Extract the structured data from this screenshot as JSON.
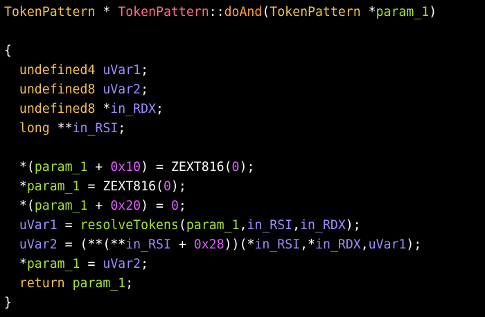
{
  "palette": {
    "default": "#ffffff",
    "type": "#f2c14e",
    "class_name": "#ff6b8b",
    "function": "#ff9d3f",
    "call": "#a6e22e",
    "param": "#a6e22e",
    "variable": "#9d8cff",
    "number": "#e05cff",
    "keyword": "#f2c14e"
  },
  "editor": {
    "lines": [
      {
        "tokens": [
          {
            "t": "TokenPattern",
            "c": "type"
          },
          {
            "t": " * ",
            "c": "default"
          },
          {
            "t": "TokenPattern",
            "c": "class_name"
          },
          {
            "t": "::",
            "c": "default"
          },
          {
            "t": "doAnd",
            "c": "function"
          },
          {
            "t": "(",
            "c": "default"
          },
          {
            "t": "TokenPattern",
            "c": "type"
          },
          {
            "t": " *",
            "c": "default"
          },
          {
            "t": "param_1",
            "c": "param"
          },
          {
            "t": ")",
            "c": "default"
          }
        ]
      },
      {
        "tokens": []
      },
      {
        "tokens": [
          {
            "t": "{",
            "c": "default"
          }
        ]
      },
      {
        "tokens": [
          {
            "t": "  ",
            "c": "default"
          },
          {
            "t": "undefined4",
            "c": "type"
          },
          {
            "t": " ",
            "c": "default"
          },
          {
            "t": "uVar1",
            "c": "variable"
          },
          {
            "t": ";",
            "c": "default"
          }
        ]
      },
      {
        "tokens": [
          {
            "t": "  ",
            "c": "default"
          },
          {
            "t": "undefined8",
            "c": "type"
          },
          {
            "t": " ",
            "c": "default"
          },
          {
            "t": "uVar2",
            "c": "variable"
          },
          {
            "t": ";",
            "c": "default"
          }
        ]
      },
      {
        "tokens": [
          {
            "t": "  ",
            "c": "default"
          },
          {
            "t": "undefined8",
            "c": "type"
          },
          {
            "t": " *",
            "c": "default"
          },
          {
            "t": "in_RDX",
            "c": "variable"
          },
          {
            "t": ";",
            "c": "default"
          }
        ]
      },
      {
        "tokens": [
          {
            "t": "  ",
            "c": "default"
          },
          {
            "t": "long",
            "c": "type"
          },
          {
            "t": " **",
            "c": "default"
          },
          {
            "t": "in_RSI",
            "c": "variable"
          },
          {
            "t": ";",
            "c": "default"
          }
        ]
      },
      {
        "tokens": []
      },
      {
        "tokens": [
          {
            "t": "  *(",
            "c": "default"
          },
          {
            "t": "param_1",
            "c": "param"
          },
          {
            "t": " + ",
            "c": "default"
          },
          {
            "t": "0x10",
            "c": "number"
          },
          {
            "t": ") = ZEXT816(",
            "c": "default"
          },
          {
            "t": "0",
            "c": "number"
          },
          {
            "t": ");",
            "c": "default"
          }
        ]
      },
      {
        "tokens": [
          {
            "t": "  *",
            "c": "default"
          },
          {
            "t": "param_1",
            "c": "param"
          },
          {
            "t": " = ZEXT816(",
            "c": "default"
          },
          {
            "t": "0",
            "c": "number"
          },
          {
            "t": ");",
            "c": "default"
          }
        ]
      },
      {
        "tokens": [
          {
            "t": "  *(",
            "c": "default"
          },
          {
            "t": "param_1",
            "c": "param"
          },
          {
            "t": " + ",
            "c": "default"
          },
          {
            "t": "0x20",
            "c": "number"
          },
          {
            "t": ") = ",
            "c": "default"
          },
          {
            "t": "0",
            "c": "number"
          },
          {
            "t": ";",
            "c": "default"
          }
        ]
      },
      {
        "tokens": [
          {
            "t": "  ",
            "c": "default"
          },
          {
            "t": "uVar1",
            "c": "variable"
          },
          {
            "t": " = ",
            "c": "default"
          },
          {
            "t": "resolveTokens",
            "c": "call"
          },
          {
            "t": "(",
            "c": "default"
          },
          {
            "t": "param_1",
            "c": "param"
          },
          {
            "t": ",",
            "c": "default"
          },
          {
            "t": "in_RSI",
            "c": "variable"
          },
          {
            "t": ",",
            "c": "default"
          },
          {
            "t": "in_RDX",
            "c": "variable"
          },
          {
            "t": ");",
            "c": "default"
          }
        ]
      },
      {
        "tokens": [
          {
            "t": "  ",
            "c": "default"
          },
          {
            "t": "uVar2",
            "c": "variable"
          },
          {
            "t": " = (**(**",
            "c": "default"
          },
          {
            "t": "in_RSI",
            "c": "variable"
          },
          {
            "t": " + ",
            "c": "default"
          },
          {
            "t": "0x28",
            "c": "number"
          },
          {
            "t": "))(*",
            "c": "default"
          },
          {
            "t": "in_RSI",
            "c": "variable"
          },
          {
            "t": ",*",
            "c": "default"
          },
          {
            "t": "in_RDX",
            "c": "variable"
          },
          {
            "t": ",",
            "c": "default"
          },
          {
            "t": "uVar1",
            "c": "variable"
          },
          {
            "t": ");",
            "c": "default"
          }
        ]
      },
      {
        "tokens": [
          {
            "t": "  *",
            "c": "default"
          },
          {
            "t": "param_1",
            "c": "param"
          },
          {
            "t": " = ",
            "c": "default"
          },
          {
            "t": "uVar2",
            "c": "variable"
          },
          {
            "t": ";",
            "c": "default"
          }
        ]
      },
      {
        "tokens": [
          {
            "t": "  ",
            "c": "default"
          },
          {
            "t": "return",
            "c": "keyword"
          },
          {
            "t": " ",
            "c": "default"
          },
          {
            "t": "param_1",
            "c": "param"
          },
          {
            "t": ";",
            "c": "default"
          }
        ]
      },
      {
        "tokens": [
          {
            "t": "}",
            "c": "default"
          }
        ]
      }
    ]
  }
}
